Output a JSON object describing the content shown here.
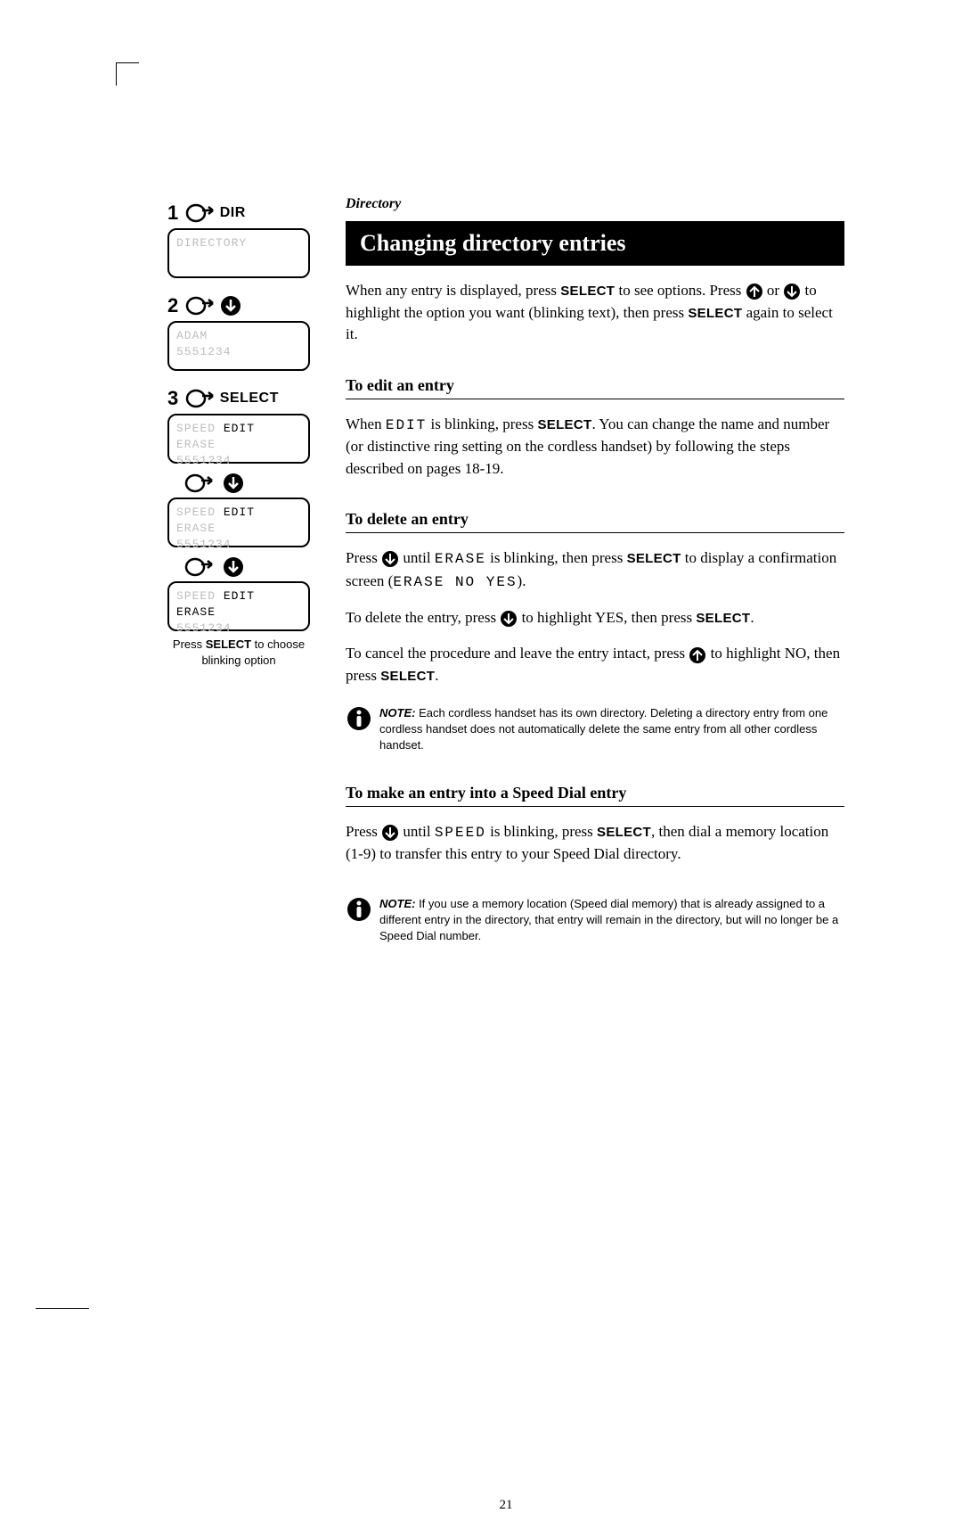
{
  "breadcrumb": "Directory",
  "title": "Changing directory entries",
  "intro": {
    "p1a": "When any entry is displayed, press ",
    "select": "SELECT",
    "p1b": " to see options. Press ",
    "p1c": " or ",
    "p1d": " to highlight the option you want (blinking text), then press ",
    "p1e": " again to select it."
  },
  "edit": {
    "heading": "To edit an entry",
    "p_a": "When ",
    "word": "EDIT",
    "p_b": " is blinking, press ",
    "select": "SELECT",
    "p_c": ". You can change the name and number (or distinctive ring setting on the cordless handset) by following the steps described on pages 18-19."
  },
  "delete": {
    "heading": "To delete an entry",
    "p1_a": "Press ",
    "p1_b": " until ",
    "w_erase": "ERASE",
    "p1_c": " is blinking, then press ",
    "select": "SELECT",
    "p1_d": " to display a confirmation screen (",
    "w_confirm": "ERASE NO YES",
    "p1_e": ").",
    "p2_a": "To delete the entry, press ",
    "p2_b": " to highlight YES, then press ",
    "p2_c": ".",
    "p3_a": "To cancel the procedure and leave the entry intact, press ",
    "p3_b": " to highlight NO, then press ",
    "p3_c": "."
  },
  "note1": {
    "label": "NOTE:",
    "text": " Each cordless handset has its own directory. Deleting a directory entry from one cordless handset does not automatically delete the same entry from all other cordless handset."
  },
  "speed": {
    "heading": "To make an entry into a Speed Dial entry",
    "p_a": "Press ",
    "p_b": " until ",
    "word": "SPEED",
    "p_c": " is blinking, press ",
    "select": "SELECT",
    "p_d": ", then dial a memory location (1-9) to transfer this entry to your Speed Dial directory."
  },
  "note2": {
    "label": "NOTE:",
    "text": " If you use a memory location (Speed dial memory) that is already assigned to a different entry in the directory, that entry will remain in the directory, but will no longer be a Speed Dial number."
  },
  "steps": {
    "s1": {
      "num": "1",
      "word": "DIR"
    },
    "s2": {
      "num": "2",
      "word": ""
    },
    "s3": {
      "num": "3",
      "word": "SELECT"
    }
  },
  "lcd": {
    "a": "DIRECTORY",
    "b1": "ADAM",
    "b2": "5551234",
    "c_speed": "SPEED",
    "c_edit": "EDIT",
    "c_erase": "ERASE",
    "c_num": "5551234"
  },
  "caption": {
    "a": "Press ",
    "b": "SELECT",
    "c": " to choose blinking option"
  },
  "page_number": "21"
}
